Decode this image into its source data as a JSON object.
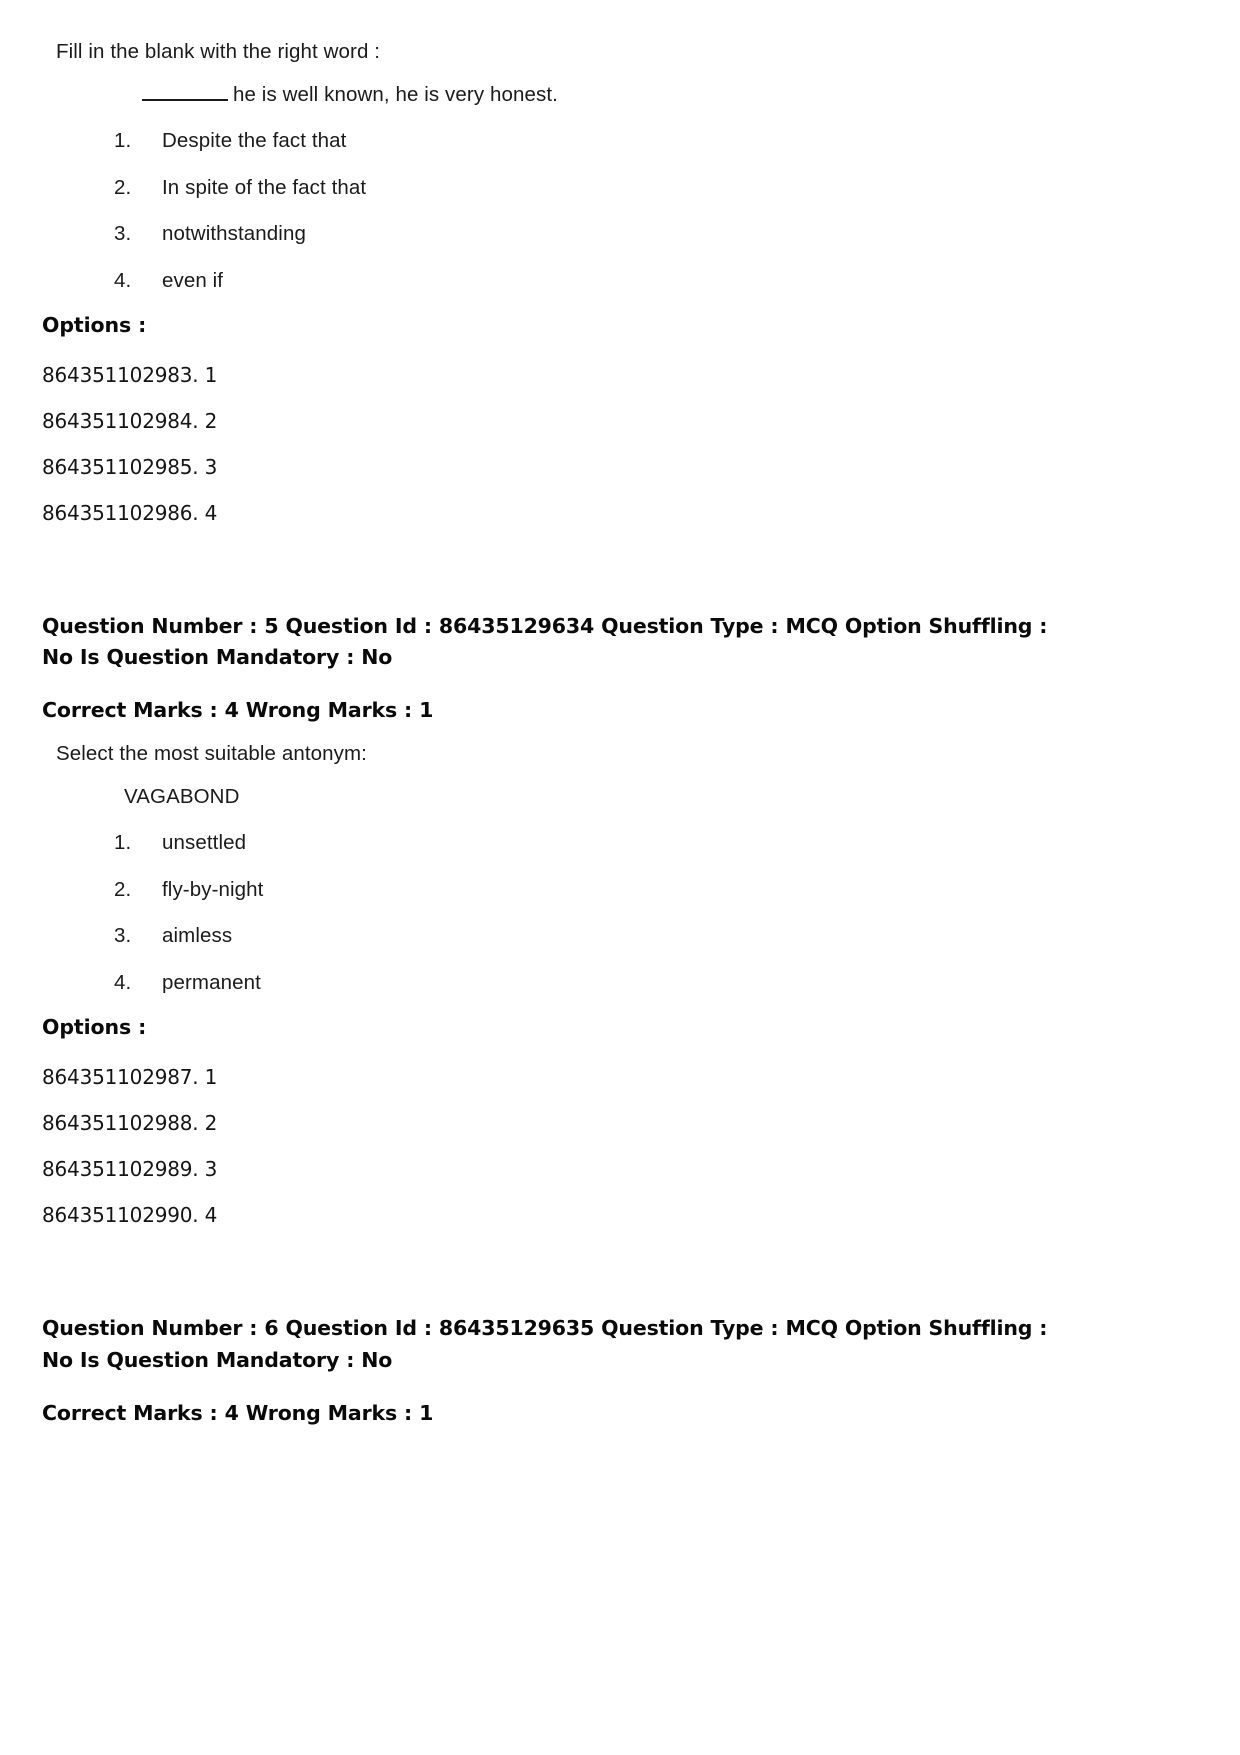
{
  "document": {
    "type": "exam-question-paper",
    "background_color": "#ffffff",
    "text_color": "#1b1b1b"
  },
  "blocks": [
    {
      "kind": "question_body",
      "prompt": "Fill in the blank with the right word :",
      "stem_prefix_blank": true,
      "stem": "he is well known, he is very honest.",
      "choices": [
        {
          "num": "1.",
          "text": "Despite the fact that"
        },
        {
          "num": "2.",
          "text": "In spite of the fact that"
        },
        {
          "num": "3.",
          "text": "notwithstanding"
        },
        {
          "num": "4.",
          "text": "even if"
        }
      ]
    }
  ],
  "question4_options": {
    "label": "Options :",
    "items": [
      "864351102983. 1",
      "864351102984. 2",
      "864351102985. 3",
      "864351102986. 4"
    ]
  },
  "question5": {
    "meta_line_1": "Question Number : 5 Question Id : 86435129634 Question Type : MCQ Option Shuffling : No Is Question Mandatory : No",
    "meta_line_2": "Correct Marks : 4 Wrong Marks : 1",
    "prompt": "Select the most suitable antonym:",
    "headword": "VAGABOND",
    "choices": [
      {
        "num": "1.",
        "text": "unsettled"
      },
      {
        "num": "2.",
        "text": "fly-by-night"
      },
      {
        "num": "3.",
        "text": "aimless"
      },
      {
        "num": "4.",
        "text": "permanent"
      }
    ],
    "options": {
      "label": "Options :",
      "items": [
        "864351102987. 1",
        "864351102988. 2",
        "864351102989. 3",
        "864351102990. 4"
      ]
    }
  },
  "question6": {
    "meta_line_1": "Question Number : 6 Question Id : 86435129635 Question Type : MCQ Option Shuffling : No Is Question Mandatory : No",
    "meta_line_2": "Correct Marks : 4 Wrong Marks : 1"
  }
}
